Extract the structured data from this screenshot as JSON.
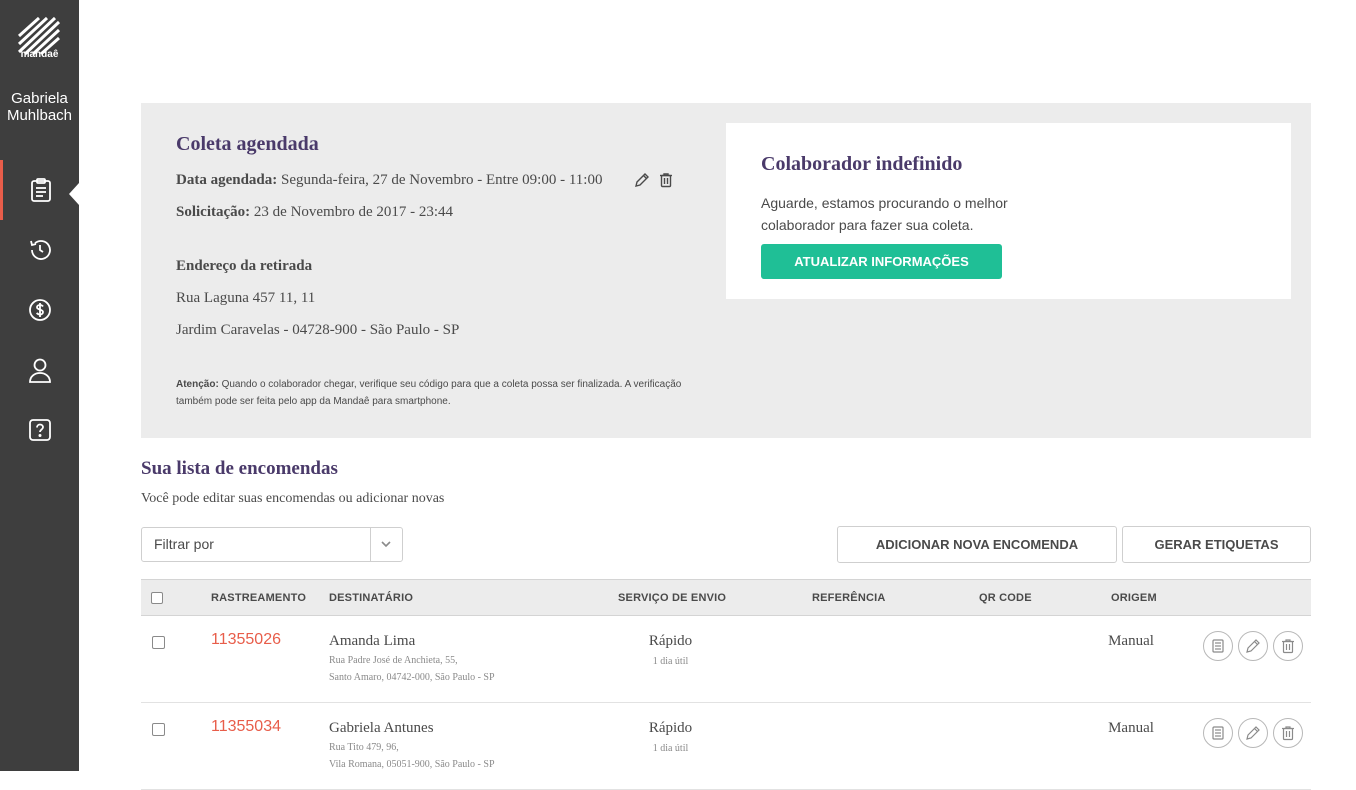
{
  "sidebar": {
    "logo_text": "mandaê",
    "user_name": "Gabriela Muhlbach",
    "nav": [
      {
        "icon": "clipboard-icon",
        "active": true
      },
      {
        "icon": "history-icon",
        "active": false
      },
      {
        "icon": "dollar-icon",
        "active": false
      },
      {
        "icon": "user-icon",
        "active": false
      },
      {
        "icon": "help-icon",
        "active": false
      }
    ]
  },
  "coleta": {
    "title": "Coleta agendada",
    "data_label": "Data agendada:",
    "data_value": "Segunda-feira, 27 de Novembro - Entre 09:00 - 11:00",
    "solicitacao_label": "Solicitação:",
    "solicitacao_value": "23 de Novembro de 2017 - 23:44",
    "endereco_label": "Endereço da retirada",
    "endereco_line1": "Rua Laguna 457 11, 11",
    "endereco_line2": "Jardim Caravelas - 04728-900 - São Paulo - SP",
    "note_label": "Atenção:",
    "note_text": "Quando o colaborador chegar, verifique seu código para que a coleta possa ser finalizada. A verificação também pode ser feita pelo app da Mandaê para smartphone."
  },
  "colaborador": {
    "title": "Colaborador indefinido",
    "text": "Aguarde, estamos procurando o melhor colaborador para fazer sua coleta.",
    "button": "ATUALIZAR INFORMAÇÕES"
  },
  "list": {
    "title": "Sua lista de encomendas",
    "subtitle": "Você pode editar suas encomendas ou adicionar novas",
    "filter_label": "Filtrar por",
    "add_button": "ADICIONAR NOVA ENCOMENDA",
    "labels_button": "GERAR ETIQUETAS",
    "columns": [
      "RASTREAMENTO",
      "DESTINATÁRIO",
      "SERVIÇO DE ENVIO",
      "REFERÊNCIA",
      "QR CODE",
      "ORIGEM"
    ],
    "rows": [
      {
        "tracking": "11355026",
        "name": "Amanda Lima",
        "addr1": "Rua Padre José de Anchieta, 55,",
        "addr2": "Santo Amaro, 04742-000, São Paulo - SP",
        "service": "Rápido",
        "service_sub": "1 dia útil",
        "origin": "Manual"
      },
      {
        "tracking": "11355034",
        "name": "Gabriela Antunes",
        "addr1": "Rua Tito 479, 96,",
        "addr2": "Vila Romana, 05051-900, São Paulo - SP",
        "service": "Rápido",
        "service_sub": "1 dia útil",
        "origin": "Manual"
      }
    ]
  },
  "colors": {
    "sidebar": "#3e3e3e",
    "accent": "#e85d4a",
    "button_green": "#1fbf96",
    "title_purple": "#4a3a6a"
  }
}
